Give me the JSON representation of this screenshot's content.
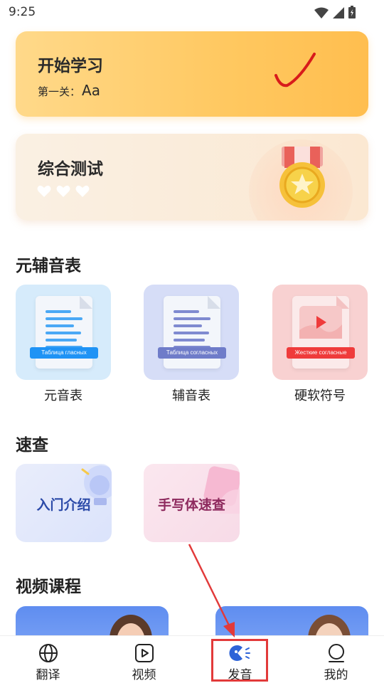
{
  "status_bar": {
    "time": "9:25",
    "icons": [
      "wifi-icon",
      "signal-icon",
      "battery-icon"
    ]
  },
  "start_card": {
    "title": "开始学习",
    "level_label": "第一关：",
    "level_value": "Aa"
  },
  "test_card": {
    "title": "综合测试",
    "hearts": 3
  },
  "sections": {
    "vowel_table": "元辅音表",
    "quick_lookup": "速查",
    "video_course": "视频课程"
  },
  "alphabet_tiles": [
    {
      "label": "元音表",
      "tag": "Таблица гласных",
      "bg": "#d6ebfb",
      "accent": "#1f93f5"
    },
    {
      "label": "辅音表",
      "tag": "Таблица согласных",
      "bg": "#d6ddf7",
      "accent": "#6f7cc9"
    },
    {
      "label": "硬软符号",
      "tag": "Жесткие согласные",
      "bg": "#f8d1d1",
      "accent": "#ef3b3b"
    }
  ],
  "quick_tiles": [
    {
      "label": "入门介绍",
      "color": "#2b4aa8"
    },
    {
      "label": "手写体速查",
      "color": "#8e2a5e"
    }
  ],
  "bottom_nav": [
    {
      "label": "翻译",
      "icon": "globe-icon"
    },
    {
      "label": "视频",
      "icon": "play-icon"
    },
    {
      "label": "发音",
      "icon": "pronunciation-icon"
    },
    {
      "label": "我的",
      "icon": "profile-icon"
    }
  ],
  "colors": {
    "annotation": "#e23a3a",
    "check": "#d81b1b"
  }
}
